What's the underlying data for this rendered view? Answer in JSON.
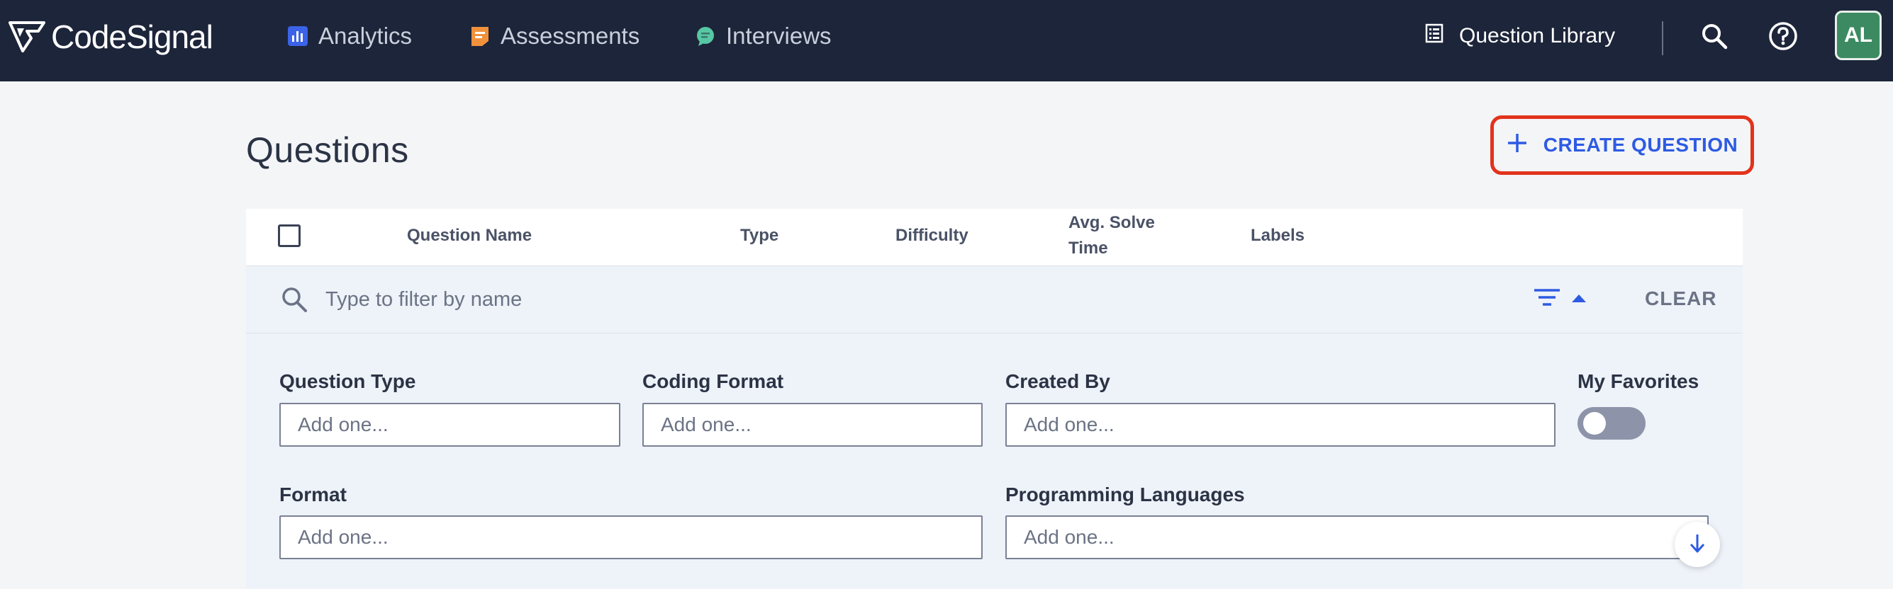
{
  "header": {
    "logo_text": "CodeSignal",
    "nav": [
      {
        "label": "Analytics",
        "icon": "analytics-icon"
      },
      {
        "label": "Assessments",
        "icon": "assessments-icon"
      },
      {
        "label": "Interviews",
        "icon": "interviews-icon"
      }
    ],
    "question_library_label": "Question Library",
    "avatar_initials": "AL"
  },
  "page": {
    "title": "Questions",
    "create_button_label": "CREATE QUESTION"
  },
  "table": {
    "columns": {
      "name": "Question Name",
      "type": "Type",
      "difficulty": "Difficulty",
      "avg_solve_time": "Avg. Solve Time",
      "labels": "Labels"
    }
  },
  "filter": {
    "search_placeholder": "Type to filter by name",
    "clear_label": "CLEAR",
    "fields": {
      "question_type": {
        "label": "Question Type",
        "placeholder": "Add one..."
      },
      "coding_format": {
        "label": "Coding Format",
        "placeholder": "Add one..."
      },
      "created_by": {
        "label": "Created By",
        "placeholder": "Add one..."
      },
      "my_favorites": {
        "label": "My Favorites",
        "enabled": false
      },
      "format": {
        "label": "Format",
        "placeholder": "Add one..."
      },
      "programming_languages": {
        "label": "Programming Languages",
        "placeholder": "Add one..."
      }
    }
  },
  "colors": {
    "topbar_bg": "#1d253a",
    "accent_blue": "#2d5be3",
    "highlight_red": "#e2331c",
    "avatar_green": "#3c8a62"
  }
}
